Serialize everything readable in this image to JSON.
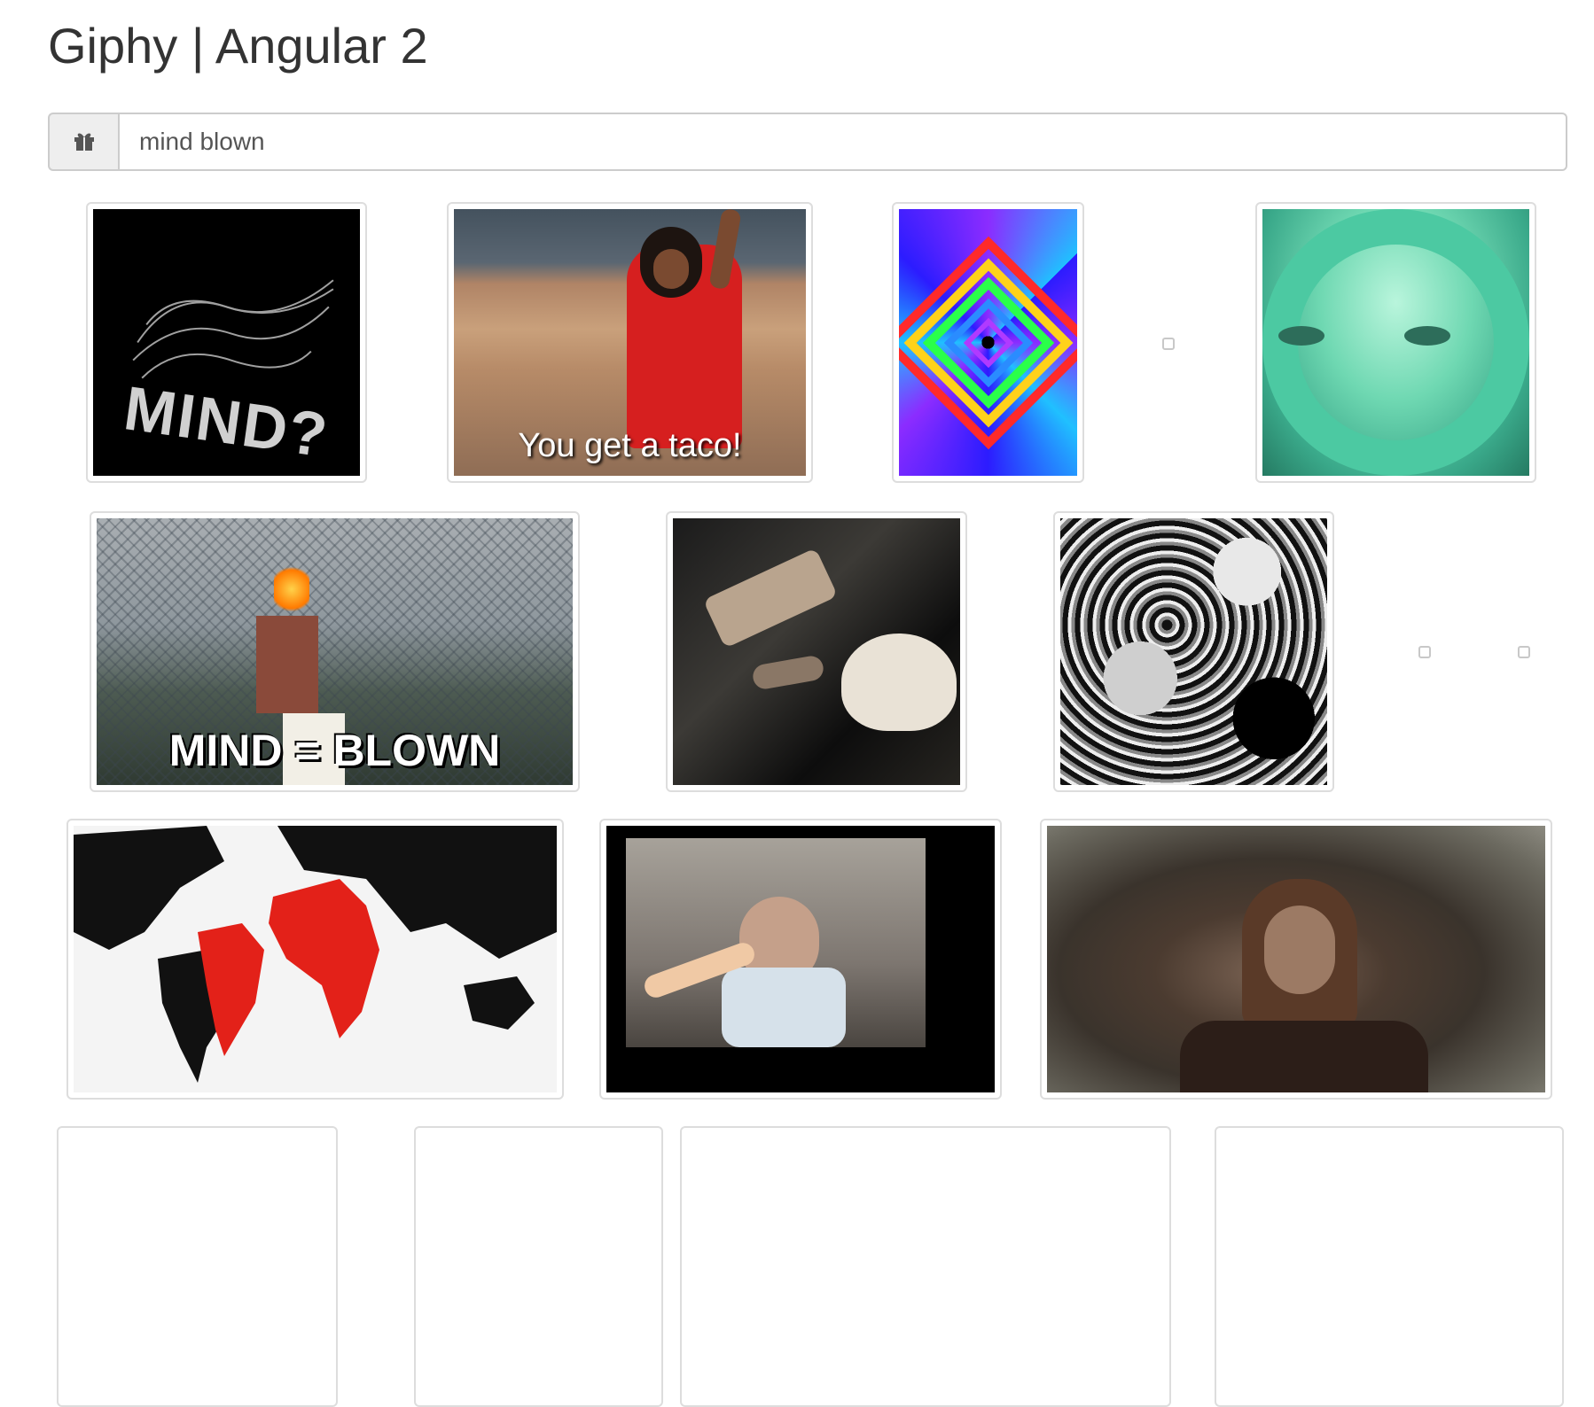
{
  "header": {
    "title": "Giphy | Angular 2"
  },
  "search": {
    "value": "mind blown",
    "icon": "gift-icon"
  },
  "gifs": [
    {
      "caption": "MIND?"
    },
    {
      "caption": "You get a taco!"
    },
    {
      "caption": ""
    },
    {
      "caption": ""
    },
    {
      "caption": "MIND = BLOWN"
    },
    {
      "caption": ""
    },
    {
      "caption": ""
    },
    {
      "caption": ""
    },
    {
      "caption": ""
    },
    {
      "caption": ""
    }
  ]
}
